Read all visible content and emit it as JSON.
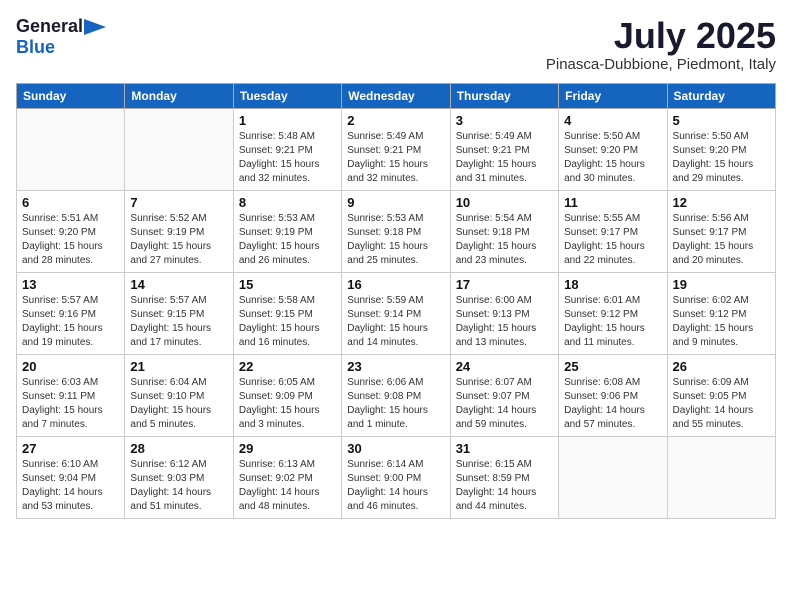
{
  "logo": {
    "general": "General",
    "blue": "Blue",
    "icon": "▶"
  },
  "title": {
    "month_year": "July 2025",
    "location": "Pinasca-Dubbione, Piedmont, Italy"
  },
  "weekdays": [
    "Sunday",
    "Monday",
    "Tuesday",
    "Wednesday",
    "Thursday",
    "Friday",
    "Saturday"
  ],
  "weeks": [
    [
      {
        "day": "",
        "info": ""
      },
      {
        "day": "",
        "info": ""
      },
      {
        "day": "1",
        "info": "Sunrise: 5:48 AM\nSunset: 9:21 PM\nDaylight: 15 hours and 32 minutes."
      },
      {
        "day": "2",
        "info": "Sunrise: 5:49 AM\nSunset: 9:21 PM\nDaylight: 15 hours and 32 minutes."
      },
      {
        "day": "3",
        "info": "Sunrise: 5:49 AM\nSunset: 9:21 PM\nDaylight: 15 hours and 31 minutes."
      },
      {
        "day": "4",
        "info": "Sunrise: 5:50 AM\nSunset: 9:20 PM\nDaylight: 15 hours and 30 minutes."
      },
      {
        "day": "5",
        "info": "Sunrise: 5:50 AM\nSunset: 9:20 PM\nDaylight: 15 hours and 29 minutes."
      }
    ],
    [
      {
        "day": "6",
        "info": "Sunrise: 5:51 AM\nSunset: 9:20 PM\nDaylight: 15 hours and 28 minutes."
      },
      {
        "day": "7",
        "info": "Sunrise: 5:52 AM\nSunset: 9:19 PM\nDaylight: 15 hours and 27 minutes."
      },
      {
        "day": "8",
        "info": "Sunrise: 5:53 AM\nSunset: 9:19 PM\nDaylight: 15 hours and 26 minutes."
      },
      {
        "day": "9",
        "info": "Sunrise: 5:53 AM\nSunset: 9:18 PM\nDaylight: 15 hours and 25 minutes."
      },
      {
        "day": "10",
        "info": "Sunrise: 5:54 AM\nSunset: 9:18 PM\nDaylight: 15 hours and 23 minutes."
      },
      {
        "day": "11",
        "info": "Sunrise: 5:55 AM\nSunset: 9:17 PM\nDaylight: 15 hours and 22 minutes."
      },
      {
        "day": "12",
        "info": "Sunrise: 5:56 AM\nSunset: 9:17 PM\nDaylight: 15 hours and 20 minutes."
      }
    ],
    [
      {
        "day": "13",
        "info": "Sunrise: 5:57 AM\nSunset: 9:16 PM\nDaylight: 15 hours and 19 minutes."
      },
      {
        "day": "14",
        "info": "Sunrise: 5:57 AM\nSunset: 9:15 PM\nDaylight: 15 hours and 17 minutes."
      },
      {
        "day": "15",
        "info": "Sunrise: 5:58 AM\nSunset: 9:15 PM\nDaylight: 15 hours and 16 minutes."
      },
      {
        "day": "16",
        "info": "Sunrise: 5:59 AM\nSunset: 9:14 PM\nDaylight: 15 hours and 14 minutes."
      },
      {
        "day": "17",
        "info": "Sunrise: 6:00 AM\nSunset: 9:13 PM\nDaylight: 15 hours and 13 minutes."
      },
      {
        "day": "18",
        "info": "Sunrise: 6:01 AM\nSunset: 9:12 PM\nDaylight: 15 hours and 11 minutes."
      },
      {
        "day": "19",
        "info": "Sunrise: 6:02 AM\nSunset: 9:12 PM\nDaylight: 15 hours and 9 minutes."
      }
    ],
    [
      {
        "day": "20",
        "info": "Sunrise: 6:03 AM\nSunset: 9:11 PM\nDaylight: 15 hours and 7 minutes."
      },
      {
        "day": "21",
        "info": "Sunrise: 6:04 AM\nSunset: 9:10 PM\nDaylight: 15 hours and 5 minutes."
      },
      {
        "day": "22",
        "info": "Sunrise: 6:05 AM\nSunset: 9:09 PM\nDaylight: 15 hours and 3 minutes."
      },
      {
        "day": "23",
        "info": "Sunrise: 6:06 AM\nSunset: 9:08 PM\nDaylight: 15 hours and 1 minute."
      },
      {
        "day": "24",
        "info": "Sunrise: 6:07 AM\nSunset: 9:07 PM\nDaylight: 14 hours and 59 minutes."
      },
      {
        "day": "25",
        "info": "Sunrise: 6:08 AM\nSunset: 9:06 PM\nDaylight: 14 hours and 57 minutes."
      },
      {
        "day": "26",
        "info": "Sunrise: 6:09 AM\nSunset: 9:05 PM\nDaylight: 14 hours and 55 minutes."
      }
    ],
    [
      {
        "day": "27",
        "info": "Sunrise: 6:10 AM\nSunset: 9:04 PM\nDaylight: 14 hours and 53 minutes."
      },
      {
        "day": "28",
        "info": "Sunrise: 6:12 AM\nSunset: 9:03 PM\nDaylight: 14 hours and 51 minutes."
      },
      {
        "day": "29",
        "info": "Sunrise: 6:13 AM\nSunset: 9:02 PM\nDaylight: 14 hours and 48 minutes."
      },
      {
        "day": "30",
        "info": "Sunrise: 6:14 AM\nSunset: 9:00 PM\nDaylight: 14 hours and 46 minutes."
      },
      {
        "day": "31",
        "info": "Sunrise: 6:15 AM\nSunset: 8:59 PM\nDaylight: 14 hours and 44 minutes."
      },
      {
        "day": "",
        "info": ""
      },
      {
        "day": "",
        "info": ""
      }
    ]
  ]
}
